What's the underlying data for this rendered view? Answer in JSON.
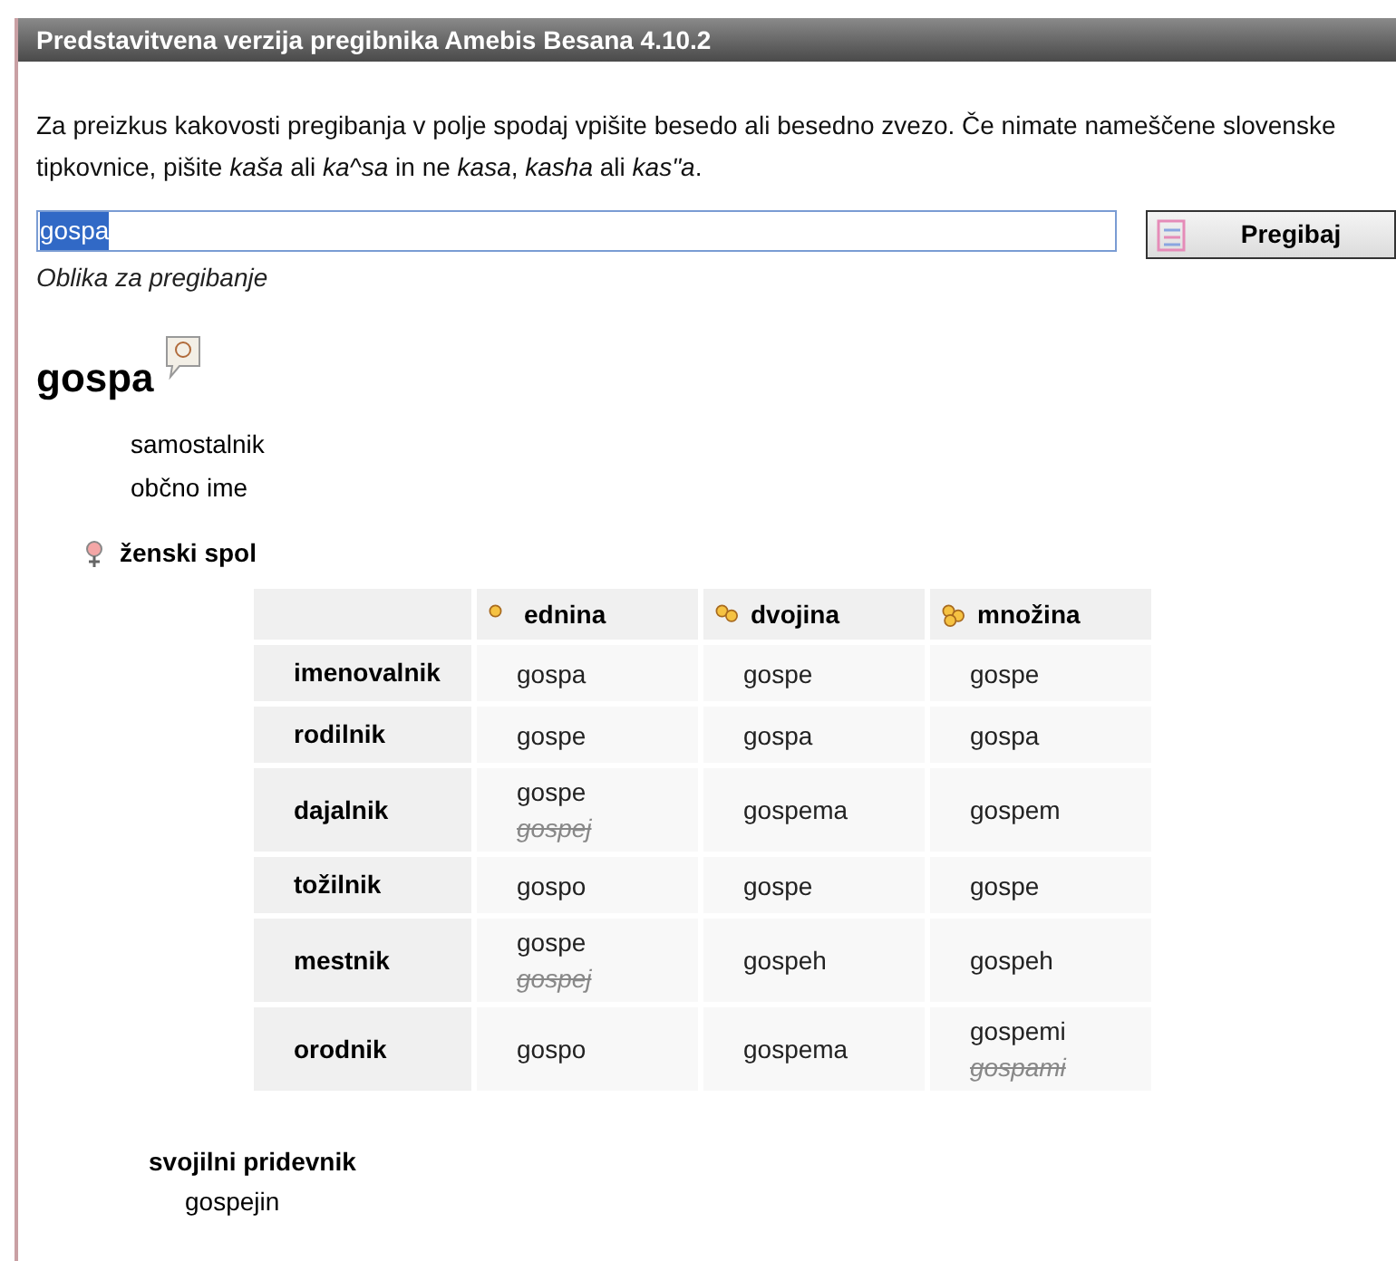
{
  "window": {
    "title": "Predstavitvena verzija pregibnika Amebis Besana 4.10.2"
  },
  "intro": "Za preizkus kakovosti pregibanja v polje spodaj vpišite besedo ali besedno zvezo. Če nimate nameščene slovenske tipkovnice, pišite *kaša* ali *ka^sa* in ne *kasa*, *kasha* ali *kas\"a*.",
  "search": {
    "value": "gospa",
    "selected": true,
    "hint": "Oblika za pregibanje"
  },
  "button": "Pregibaj",
  "word": "gospa",
  "properties": [
    "samostalnik",
    "občno ime"
  ],
  "gender": "ženski spol",
  "table": {
    "columns": [
      "ednina",
      "dvojina",
      "množina"
    ],
    "rows": [
      {
        "label": "imenovalnik",
        "cells": [
          [
            {
              "text": "gospa",
              "struck": false
            }
          ],
          [
            {
              "text": "gospe",
              "struck": false
            }
          ],
          [
            {
              "text": "gospe",
              "struck": false
            }
          ]
        ]
      },
      {
        "label": "rodilnik",
        "cells": [
          [
            {
              "text": "gospe",
              "struck": false
            }
          ],
          [
            {
              "text": "gospa",
              "struck": false
            }
          ],
          [
            {
              "text": "gospa",
              "struck": false
            }
          ]
        ]
      },
      {
        "label": "dajalnik",
        "cells": [
          [
            {
              "text": "gospe",
              "struck": false
            },
            {
              "text": "gospej",
              "struck": true
            }
          ],
          [
            {
              "text": "gospema",
              "struck": false
            }
          ],
          [
            {
              "text": "gospem",
              "struck": false
            }
          ]
        ]
      },
      {
        "label": "tožilnik",
        "cells": [
          [
            {
              "text": "gospo",
              "struck": false
            }
          ],
          [
            {
              "text": "gospe",
              "struck": false
            }
          ],
          [
            {
              "text": "gospe",
              "struck": false
            }
          ]
        ]
      },
      {
        "label": "mestnik",
        "cells": [
          [
            {
              "text": "gospe",
              "struck": false
            },
            {
              "text": "gospej",
              "struck": true
            }
          ],
          [
            {
              "text": "gospeh",
              "struck": false
            }
          ],
          [
            {
              "text": "gospeh",
              "struck": false
            }
          ]
        ]
      },
      {
        "label": "orodnik",
        "cells": [
          [
            {
              "text": "gospo",
              "struck": false
            }
          ],
          [
            {
              "text": "gospema",
              "struck": false
            }
          ],
          [
            {
              "text": "gospemi",
              "struck": false
            },
            {
              "text": "gospami",
              "struck": true
            }
          ]
        ]
      }
    ]
  },
  "possessive": {
    "title": "svojilni pridevnik",
    "forms": [
      "gospejin"
    ]
  }
}
